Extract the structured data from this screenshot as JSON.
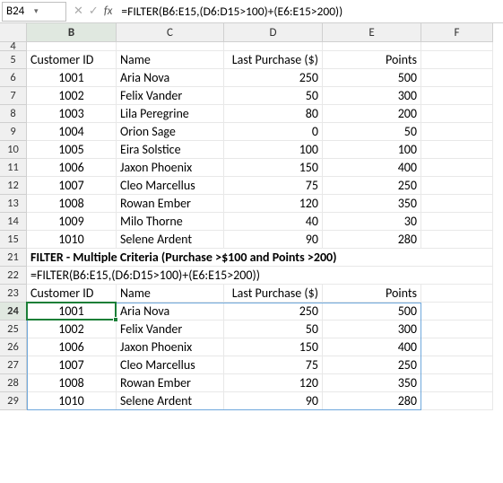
{
  "formulaBar": {
    "cellRef": "B24",
    "formula": "=FILTER(B6:E15,(D6:D15>100)+(E6:E15>200))"
  },
  "columns": [
    "B",
    "C",
    "D",
    "E",
    "F"
  ],
  "rowLabels": [
    "4",
    "5",
    "6",
    "7",
    "8",
    "9",
    "10",
    "11",
    "12",
    "13",
    "14",
    "15",
    "21",
    "22",
    "23",
    "24",
    "25",
    "26",
    "27",
    "28",
    "29"
  ],
  "headers": {
    "custId": "Customer ID",
    "name": "Name",
    "lastPurchase": "Last Purchase ($)",
    "points": "Points"
  },
  "source": [
    {
      "id": "1001",
      "name": "Aria Nova",
      "purchase": "250",
      "points": "500"
    },
    {
      "id": "1002",
      "name": "Felix Vander",
      "purchase": "50",
      "points": "300"
    },
    {
      "id": "1003",
      "name": "Lila Peregrine",
      "purchase": "80",
      "points": "200"
    },
    {
      "id": "1004",
      "name": "Orion Sage",
      "purchase": "0",
      "points": "50"
    },
    {
      "id": "1005",
      "name": "Eira Solstice",
      "purchase": "100",
      "points": "100"
    },
    {
      "id": "1006",
      "name": "Jaxon Phoenix",
      "purchase": "150",
      "points": "400"
    },
    {
      "id": "1007",
      "name": "Cleo Marcellus",
      "purchase": "75",
      "points": "250"
    },
    {
      "id": "1008",
      "name": "Rowan Ember",
      "purchase": "120",
      "points": "350"
    },
    {
      "id": "1009",
      "name": "Milo Thorne",
      "purchase": "40",
      "points": "30"
    },
    {
      "id": "1010",
      "name": "Selene Ardent",
      "purchase": "90",
      "points": "280"
    }
  ],
  "section": {
    "title": "FILTER - Multiple Criteria (Purchase >$100 and Points >200)",
    "formulaText": "=FILTER(B6:E15,(D6:D15>100)+(E6:E15>200))"
  },
  "result": [
    {
      "id": "1001",
      "name": "Aria Nova",
      "purchase": "250",
      "points": "500"
    },
    {
      "id": "1002",
      "name": "Felix Vander",
      "purchase": "50",
      "points": "300"
    },
    {
      "id": "1006",
      "name": "Jaxon Phoenix",
      "purchase": "150",
      "points": "400"
    },
    {
      "id": "1007",
      "name": "Cleo Marcellus",
      "purchase": "75",
      "points": "250"
    },
    {
      "id": "1008",
      "name": "Rowan Ember",
      "purchase": "120",
      "points": "350"
    },
    {
      "id": "1010",
      "name": "Selene Ardent",
      "purchase": "90",
      "points": "280"
    }
  ],
  "chart_data": {
    "type": "table",
    "title": "FILTER - Multiple Criteria (Purchase >$100 and Points >200)",
    "columns": [
      "Customer ID",
      "Name",
      "Last Purchase ($)",
      "Points"
    ],
    "source_rows": [
      [
        "1001",
        "Aria Nova",
        250,
        500
      ],
      [
        "1002",
        "Felix Vander",
        50,
        300
      ],
      [
        "1003",
        "Lila Peregrine",
        80,
        200
      ],
      [
        "1004",
        "Orion Sage",
        0,
        50
      ],
      [
        "1005",
        "Eira Solstice",
        100,
        100
      ],
      [
        "1006",
        "Jaxon Phoenix",
        150,
        400
      ],
      [
        "1007",
        "Cleo Marcellus",
        75,
        250
      ],
      [
        "1008",
        "Rowan Ember",
        120,
        350
      ],
      [
        "1009",
        "Milo Thorne",
        40,
        30
      ],
      [
        "1010",
        "Selene Ardent",
        90,
        280
      ]
    ],
    "result_rows": [
      [
        "1001",
        "Aria Nova",
        250,
        500
      ],
      [
        "1002",
        "Felix Vander",
        50,
        300
      ],
      [
        "1006",
        "Jaxon Phoenix",
        150,
        400
      ],
      [
        "1007",
        "Cleo Marcellus",
        75,
        250
      ],
      [
        "1008",
        "Rowan Ember",
        120,
        350
      ],
      [
        "1010",
        "Selene Ardent",
        90,
        280
      ]
    ]
  }
}
